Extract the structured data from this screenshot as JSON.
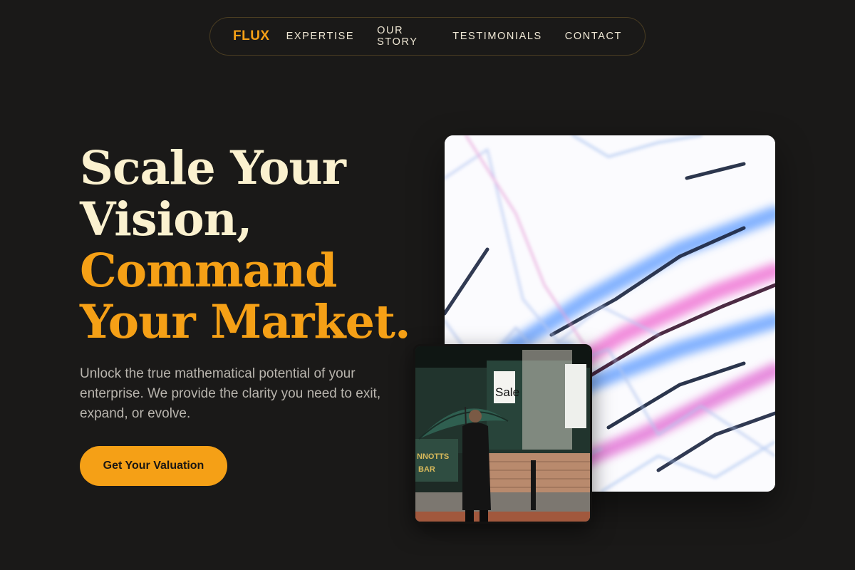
{
  "nav": {
    "brand": "FLUX",
    "links": [
      "EXPERTISE",
      "OUR STORY",
      "TESTIMONIALS",
      "CONTACT"
    ]
  },
  "hero": {
    "title_line1": "Scale Your",
    "title_line2": "Vision,",
    "title_line3": "Command",
    "title_line4": "Your Market.",
    "description": "Unlock the true mathematical potential of your enterprise. We provide the clarity you need to exit, expand, or evolve.",
    "cta_label": "Get Your Valuation"
  },
  "colors": {
    "background": "#1a1918",
    "accent": "#f5a016",
    "headline_cream": "#fbf1cf",
    "body_text": "#b9b5ae"
  },
  "images": {
    "main_alt": "abstract neon light streaks",
    "secondary_alt": "man with umbrella on city street",
    "secondary_sign": "Sale"
  }
}
